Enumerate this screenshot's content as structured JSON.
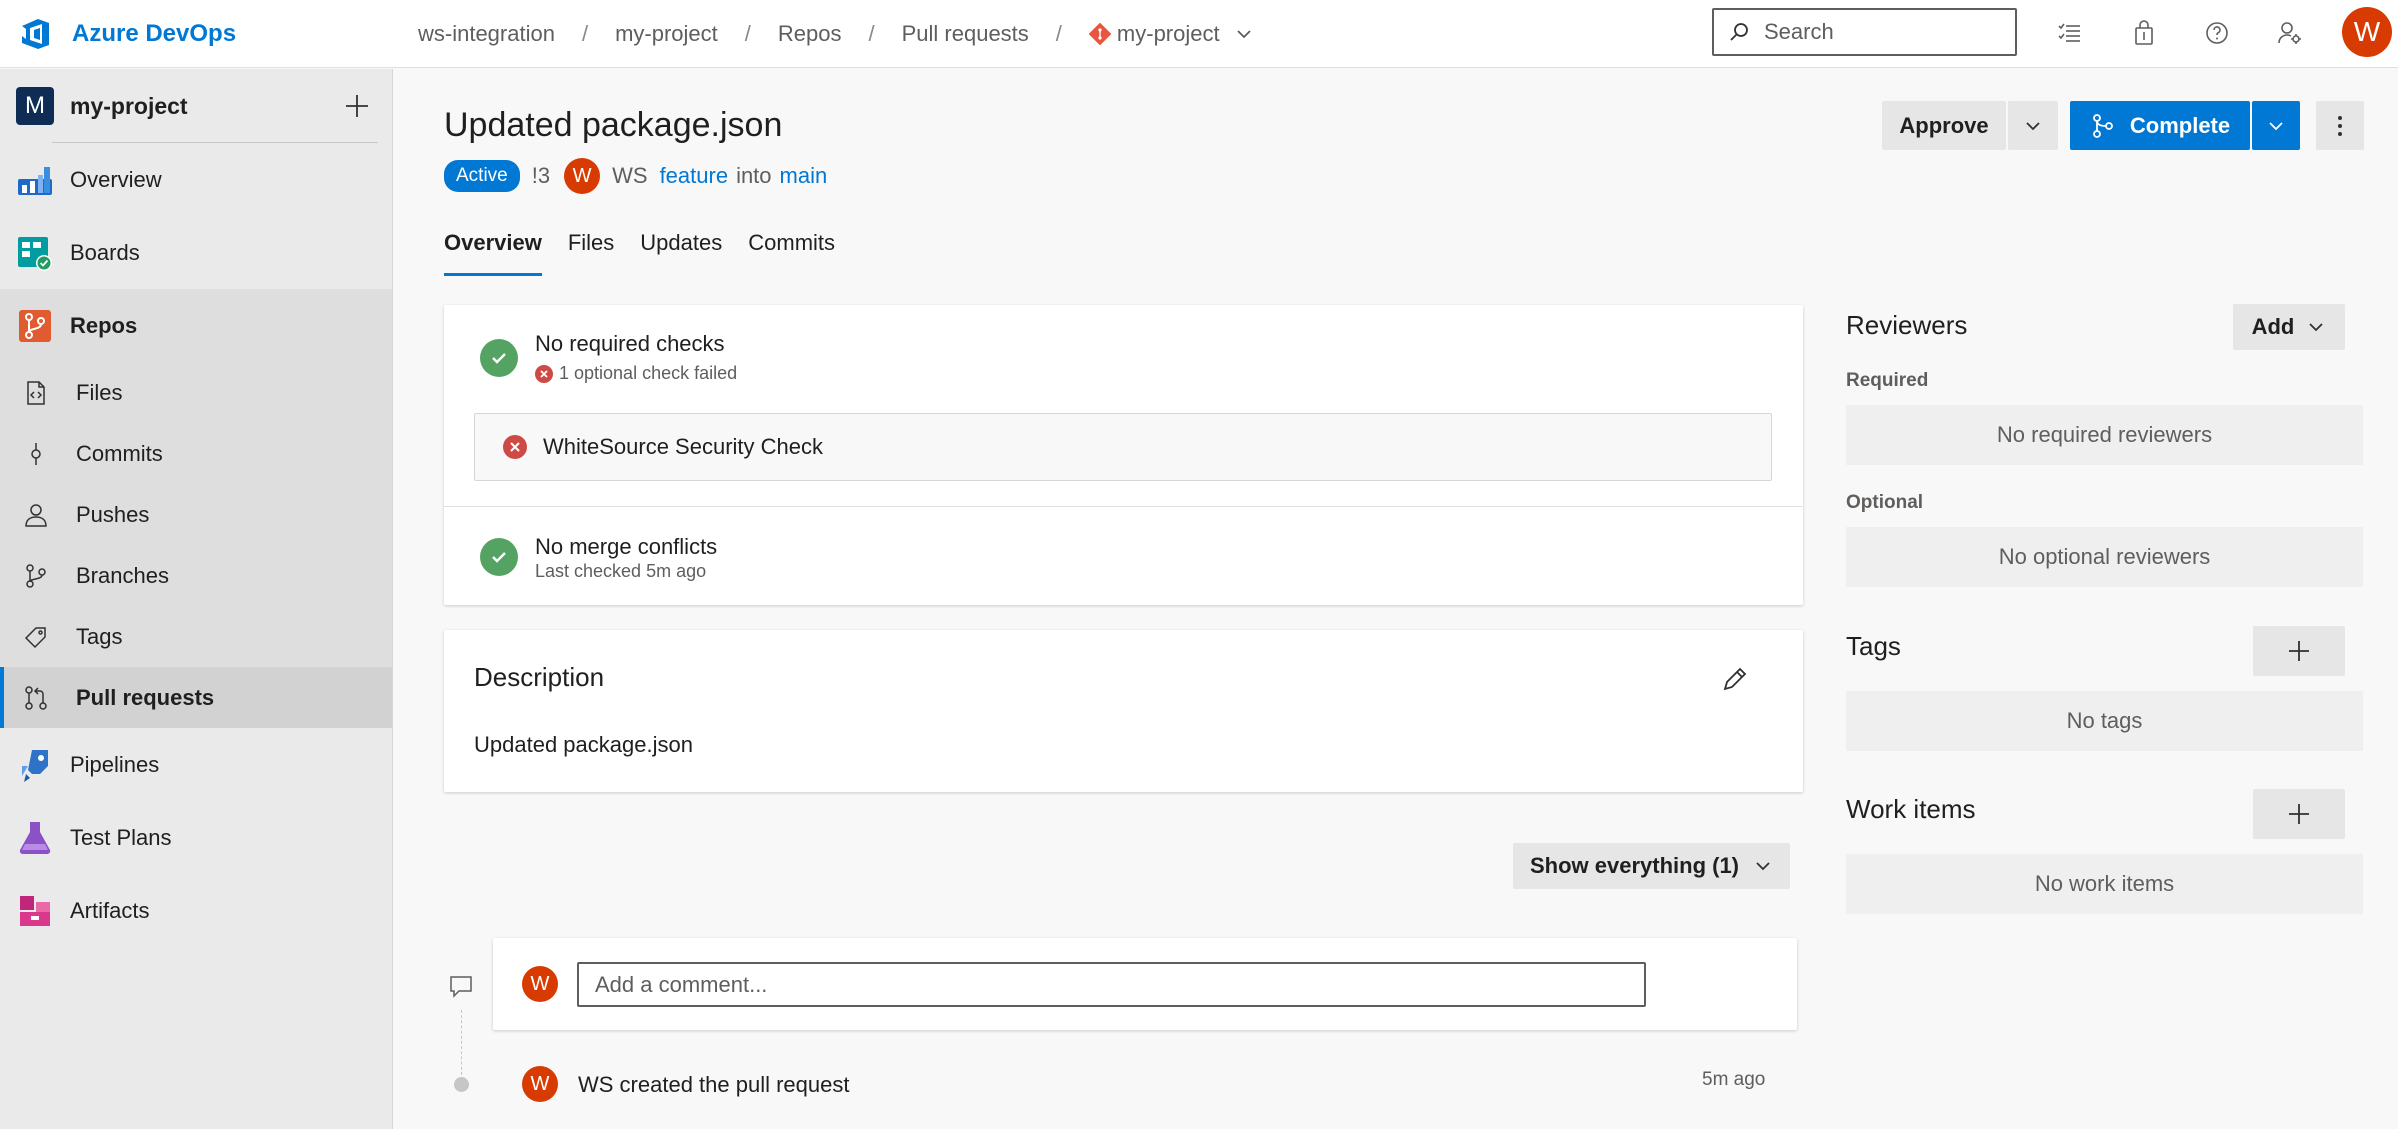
{
  "app": {
    "name": "Azure DevOps"
  },
  "breadcrumb": {
    "org": "ws-integration",
    "project": "my-project",
    "section": "Repos",
    "page": "Pull requests",
    "repo": "my-project",
    "separator": "/"
  },
  "search": {
    "placeholder": "Search"
  },
  "user": {
    "initial": "W"
  },
  "sidebar": {
    "project_initial": "M",
    "project_name": "my-project",
    "items": [
      {
        "label": "Overview"
      },
      {
        "label": "Boards"
      },
      {
        "label": "Repos"
      },
      {
        "label": "Files"
      },
      {
        "label": "Commits"
      },
      {
        "label": "Pushes"
      },
      {
        "label": "Branches"
      },
      {
        "label": "Tags"
      },
      {
        "label": "Pull requests"
      },
      {
        "label": "Pipelines"
      },
      {
        "label": "Test Plans"
      },
      {
        "label": "Artifacts"
      }
    ]
  },
  "pr": {
    "title": "Updated package.json",
    "status": "Active",
    "id": "!3",
    "author_initial": "W",
    "author": "WS",
    "source_branch": "feature",
    "into": "into",
    "target_branch": "main"
  },
  "actions": {
    "approve": "Approve",
    "complete": "Complete"
  },
  "tabs": [
    {
      "label": "Overview"
    },
    {
      "label": "Files"
    },
    {
      "label": "Updates"
    },
    {
      "label": "Commits"
    }
  ],
  "checks": {
    "required_title": "No required checks",
    "optional_summary": "1 optional check failed",
    "failed_check_name": "WhiteSource Security Check",
    "merge_title": "No merge conflicts",
    "merge_sub": "Last checked 5m ago"
  },
  "description": {
    "heading": "Description",
    "text": "Updated package.json"
  },
  "filter": {
    "label": "Show everything (1)"
  },
  "comment": {
    "avatar_initial": "W",
    "placeholder": "Add a comment..."
  },
  "activity": {
    "avatar_initial": "W",
    "text": "WS created the pull request",
    "time": "5m ago"
  },
  "reviewers": {
    "heading": "Reviewers",
    "add_label": "Add",
    "required_label": "Required",
    "required_empty": "No required reviewers",
    "optional_label": "Optional",
    "optional_empty": "No optional reviewers"
  },
  "tags_panel": {
    "heading": "Tags",
    "empty": "No tags"
  },
  "work_items": {
    "heading": "Work items",
    "empty": "No work items"
  },
  "colors": {
    "accent": "#0078d4",
    "avatar": "#d83b01",
    "success": "#55a362",
    "error": "#cd4a45"
  }
}
